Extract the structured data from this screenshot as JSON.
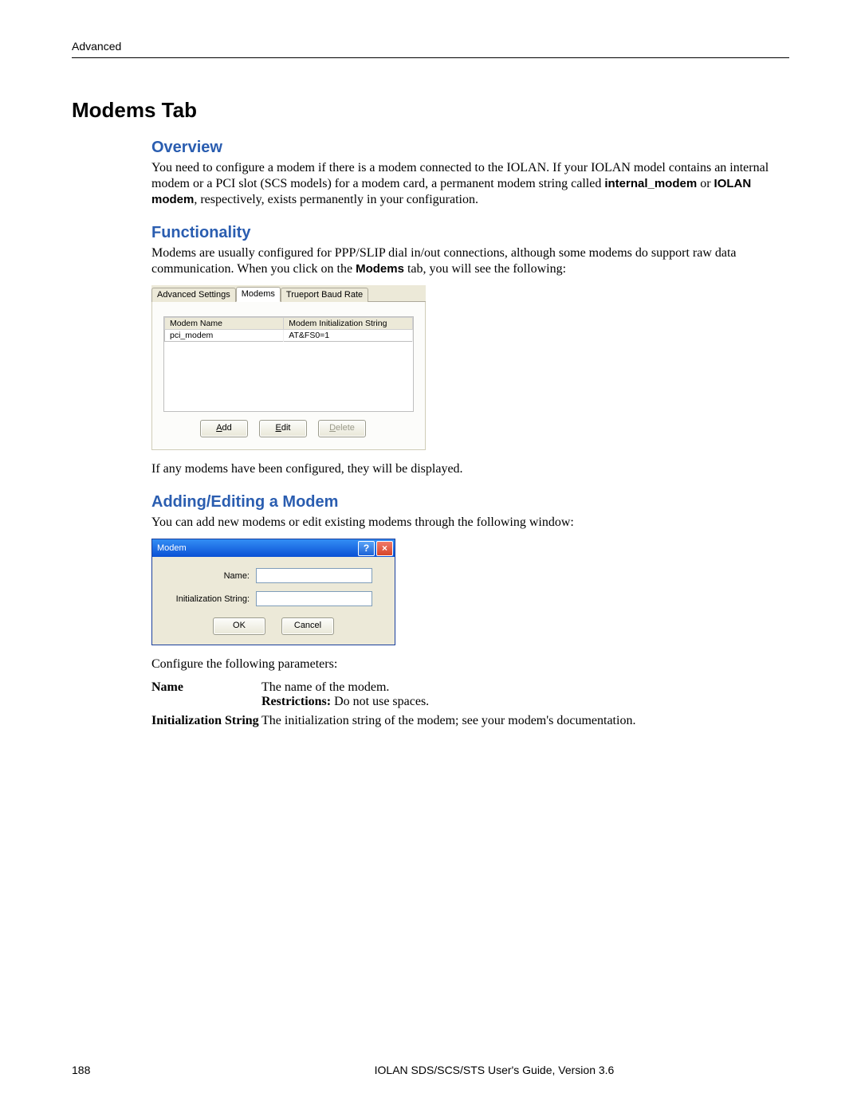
{
  "breadcrumb": "Advanced",
  "heading": "Modems Tab",
  "sections": {
    "overview": {
      "title": "Overview",
      "p1a": "You need to configure a modem if there is a modem connected to the IOLAN. If your IOLAN model contains an internal modem or a PCI slot (SCS models) for a modem card, a permanent modem string called ",
      "p1b": "internal_modem",
      "p1c": " or ",
      "p1d": "IOLAN modem",
      "p1e": ", respectively, exists permanently in your configuration."
    },
    "functionality": {
      "title": "Functionality",
      "p1a": "Modems are usually configured for PPP/SLIP dial in/out connections, although some modems do support raw data communication. When you click on the ",
      "p1b": "Modems",
      "p1c": " tab, you will see the following:",
      "after": "If any modems have been configured, they will be displayed."
    },
    "adding": {
      "title": "Adding/Editing a Modem",
      "p1": "You can add new modems or edit existing modems through the following window:",
      "after": "Configure the following parameters:"
    }
  },
  "shot1": {
    "tabs": [
      "Advanced Settings",
      "Modems",
      "Trueport Baud Rate"
    ],
    "activeTab": 1,
    "columns": [
      "Modem Name",
      "Modem Initialization String"
    ],
    "rows": [
      {
        "name": "pci_modem",
        "init": "AT&FS0=1"
      }
    ],
    "buttons": {
      "add_pre": "",
      "add_u": "A",
      "add_post": "dd",
      "edit_pre": "",
      "edit_u": "E",
      "edit_post": "dit",
      "del_pre": "",
      "del_u": "D",
      "del_post": "elete"
    }
  },
  "shot2": {
    "title": "Modem",
    "labels": {
      "name": "Name:",
      "init": "Initialization String:"
    },
    "values": {
      "name": "",
      "init": ""
    },
    "buttons": {
      "ok": "OK",
      "cancel": "Cancel"
    }
  },
  "params": {
    "name": {
      "label": "Name",
      "desc": "The name of the modem.",
      "restrict_label": "Restrictions:",
      "restrict_text": " Do not use spaces."
    },
    "init": {
      "label": "Initialization String",
      "desc": "The initialization string of the modem; see your modem's documentation."
    }
  },
  "footer": {
    "page": "188",
    "title": "IOLAN SDS/SCS/STS User's Guide, Version 3.6"
  }
}
